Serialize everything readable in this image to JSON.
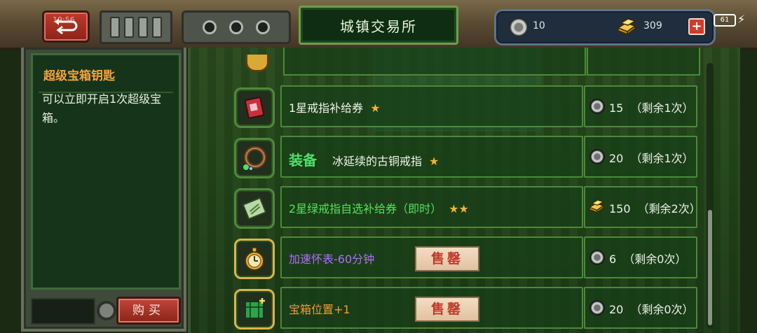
{
  "header": {
    "title": "城镇交易所",
    "back_time": "19:56",
    "coins": "10",
    "gold": "309",
    "plus": "+",
    "battery": "61"
  },
  "detail": {
    "name": "超级宝箱钥匙",
    "description": "可以立即开启1次超级宝箱。",
    "buy_label": "购买"
  },
  "items": [
    {
      "tag": "",
      "name": "1星戒指补给券",
      "stars": "★",
      "name_color": "#f1f4ec",
      "sold_label": "",
      "currency": "coin",
      "price": "15",
      "remaining": "（剩余1次）",
      "icon": "red-ticket-icon"
    },
    {
      "tag": "装备",
      "name": "冰延续的古铜戒指",
      "stars": "★",
      "name_color": "#f1f4ec",
      "sold_label": "",
      "currency": "coin",
      "price": "20",
      "remaining": "（剩余1次）",
      "icon": "bronze-ring-icon"
    },
    {
      "tag": "",
      "name": "2星绿戒指自选补给券（即时）",
      "stars": "★★",
      "name_color": "#58e05e",
      "sold_label": "",
      "currency": "gold",
      "price": "150",
      "remaining": "（剩余2次）",
      "icon": "green-ticket-icon"
    },
    {
      "tag": "",
      "name": "加速怀表-60分钟",
      "stars": "",
      "name_color": "#b46bff",
      "sold_label": "售罄",
      "currency": "coin",
      "price": "6",
      "remaining": "（剩余0次）",
      "icon": "pocket-watch-icon"
    },
    {
      "tag": "",
      "name": "宝箱位置+1",
      "stars": "",
      "name_color": "#f39a34",
      "sold_label": "售罄",
      "currency": "coin",
      "price": "20",
      "remaining": "（剩余0次）",
      "icon": "chest-slot-icon"
    }
  ]
}
